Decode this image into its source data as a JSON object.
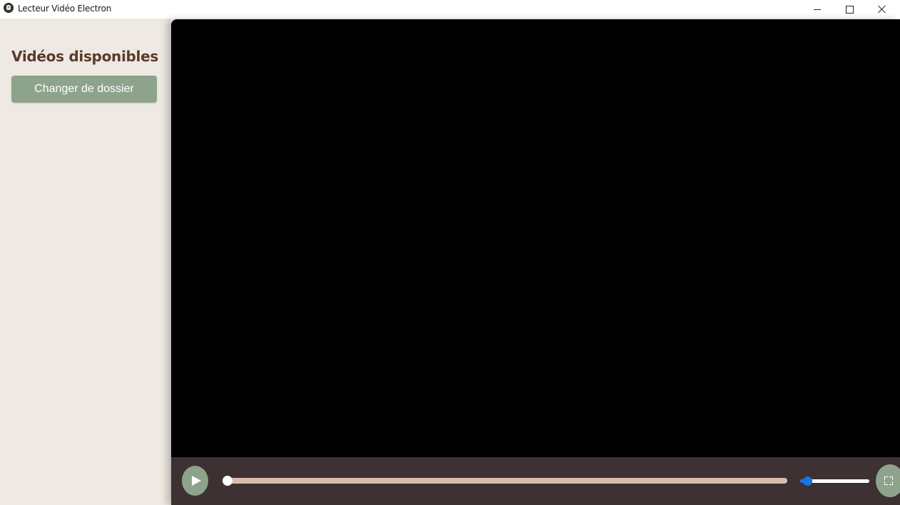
{
  "window": {
    "title": "Lecteur Vidéo Electron",
    "icon": "app-logo-icon",
    "controls": [
      "minimize-icon",
      "maximize-icon",
      "close-icon"
    ]
  },
  "sidebar": {
    "title": "Vidéos disponibles",
    "change_folder_label": "Changer de dossier"
  },
  "player": {
    "state": "paused",
    "progress": 0,
    "volume": 0.1,
    "icons": {
      "play": "play-icon",
      "fullscreen": "fullscreen-icon"
    }
  },
  "colors": {
    "sidebar_bg": "#efe9e3",
    "title_text": "#5b3a2b",
    "accent_green": "#8ea38c",
    "controls_bg": "#3d3133",
    "progress_track": "#d9bcad",
    "volume_blue": "#1a73e8",
    "video_bg": "#000000"
  }
}
